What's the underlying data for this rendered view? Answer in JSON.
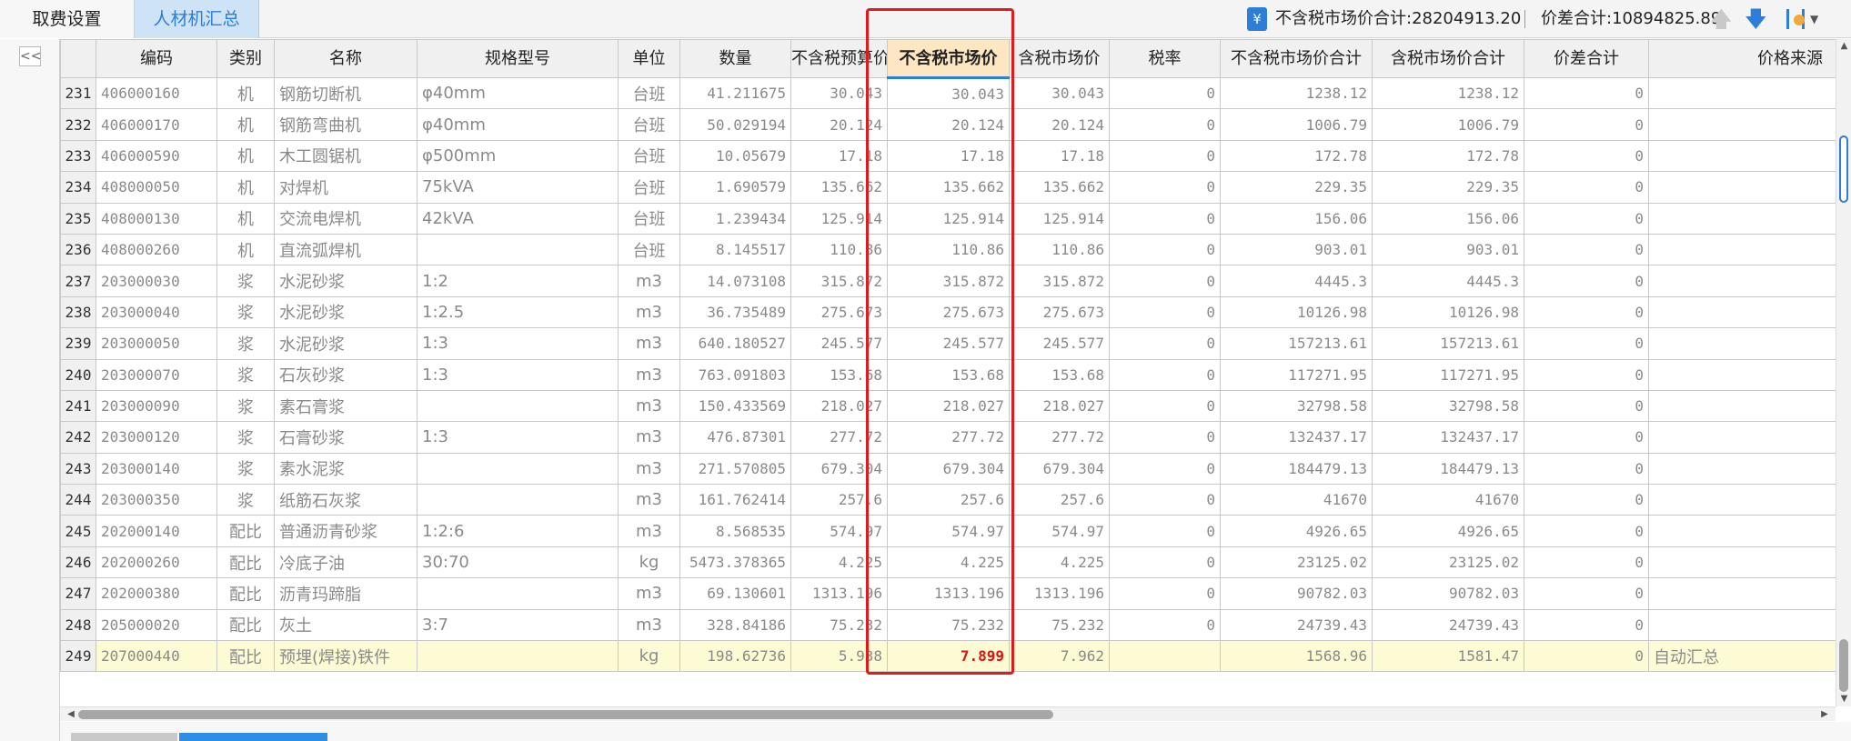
{
  "tabs": [
    "取费设置",
    "人材机汇总"
  ],
  "summary": {
    "icon": "¥",
    "market_total": "不含税市场价合计:28204913.20",
    "diff_total": "价差合计:10894825.89"
  },
  "colors": {
    "accent": "#2d7ed6",
    "highlight": "#e01b1b",
    "selected_header": "#fde7c3",
    "last_row": "#fdfbd4"
  },
  "left": {
    "collapse_glyph": "<<"
  },
  "columns": [
    "",
    "编码",
    "类别",
    "名称",
    "规格型号",
    "单位",
    "数量",
    "不含税预算价",
    "不含税市场价",
    "含税市场价",
    "税率",
    "不含税市场价合计",
    "含税市场价合计",
    "价差合计",
    "价格来源"
  ],
  "rows": [
    [
      "231",
      "406000160",
      "机",
      "钢筋切断机",
      "φ40mm",
      "台班",
      "41.211675",
      "30.043",
      "30.043",
      "30.043",
      "0",
      "1238.12",
      "1238.12",
      "0",
      ""
    ],
    [
      "232",
      "406000170",
      "机",
      "钢筋弯曲机",
      "φ40mm",
      "台班",
      "50.029194",
      "20.124",
      "20.124",
      "20.124",
      "0",
      "1006.79",
      "1006.79",
      "0",
      ""
    ],
    [
      "233",
      "406000590",
      "机",
      "木工圆锯机",
      "φ500mm",
      "台班",
      "10.05679",
      "17.18",
      "17.18",
      "17.18",
      "0",
      "172.78",
      "172.78",
      "0",
      ""
    ],
    [
      "234",
      "408000050",
      "机",
      "对焊机",
      "75kVA",
      "台班",
      "1.690579",
      "135.662",
      "135.662",
      "135.662",
      "0",
      "229.35",
      "229.35",
      "0",
      ""
    ],
    [
      "235",
      "408000130",
      "机",
      "交流电焊机",
      "42kVA",
      "台班",
      "1.239434",
      "125.914",
      "125.914",
      "125.914",
      "0",
      "156.06",
      "156.06",
      "0",
      ""
    ],
    [
      "236",
      "408000260",
      "机",
      "直流弧焊机",
      "",
      "台班",
      "8.145517",
      "110.86",
      "110.86",
      "110.86",
      "0",
      "903.01",
      "903.01",
      "0",
      ""
    ],
    [
      "237",
      "203000030",
      "浆",
      "水泥砂浆",
      "1:2",
      "m3",
      "14.073108",
      "315.872",
      "315.872",
      "315.872",
      "0",
      "4445.3",
      "4445.3",
      "0",
      ""
    ],
    [
      "238",
      "203000040",
      "浆",
      "水泥砂浆",
      "1:2.5",
      "m3",
      "36.735489",
      "275.673",
      "275.673",
      "275.673",
      "0",
      "10126.98",
      "10126.98",
      "0",
      ""
    ],
    [
      "239",
      "203000050",
      "浆",
      "水泥砂浆",
      "1:3",
      "m3",
      "640.180527",
      "245.577",
      "245.577",
      "245.577",
      "0",
      "157213.61",
      "157213.61",
      "0",
      ""
    ],
    [
      "240",
      "203000070",
      "浆",
      "石灰砂浆",
      "1:3",
      "m3",
      "763.091803",
      "153.68",
      "153.68",
      "153.68",
      "0",
      "117271.95",
      "117271.95",
      "0",
      ""
    ],
    [
      "241",
      "203000090",
      "浆",
      "素石膏浆",
      "",
      "m3",
      "150.433569",
      "218.027",
      "218.027",
      "218.027",
      "0",
      "32798.58",
      "32798.58",
      "0",
      ""
    ],
    [
      "242",
      "203000120",
      "浆",
      "石膏砂浆",
      "1:3",
      "m3",
      "476.87301",
      "277.72",
      "277.72",
      "277.72",
      "0",
      "132437.17",
      "132437.17",
      "0",
      ""
    ],
    [
      "243",
      "203000140",
      "浆",
      "素水泥浆",
      "",
      "m3",
      "271.570805",
      "679.304",
      "679.304",
      "679.304",
      "0",
      "184479.13",
      "184479.13",
      "0",
      ""
    ],
    [
      "244",
      "203000350",
      "浆",
      "纸筋石灰浆",
      "",
      "m3",
      "161.762414",
      "257.6",
      "257.6",
      "257.6",
      "0",
      "41670",
      "41670",
      "0",
      ""
    ],
    [
      "245",
      "202000140",
      "配比",
      "普通沥青砂浆",
      "1:2:6",
      "m3",
      "8.568535",
      "574.97",
      "574.97",
      "574.97",
      "0",
      "4926.65",
      "4926.65",
      "0",
      ""
    ],
    [
      "246",
      "202000260",
      "配比",
      "冷底子油",
      "30:70",
      "kg",
      "5473.378365",
      "4.225",
      "4.225",
      "4.225",
      "0",
      "23125.02",
      "23125.02",
      "0",
      ""
    ],
    [
      "247",
      "202000380",
      "配比",
      "沥青玛蹄脂",
      "",
      "m3",
      "69.130601",
      "1313.196",
      "1313.196",
      "1313.196",
      "0",
      "90782.03",
      "90782.03",
      "0",
      ""
    ],
    [
      "248",
      "205000020",
      "配比",
      "灰土",
      "3:7",
      "m3",
      "328.84186",
      "75.232",
      "75.232",
      "75.232",
      "0",
      "24739.43",
      "24739.43",
      "0",
      ""
    ],
    [
      "249",
      "207000440",
      "配比",
      "预埋(焊接)铁件",
      "",
      "kg",
      "198.62736",
      "5.938",
      "7.899",
      "7.962",
      "",
      "1568.96",
      "1581.47",
      "0",
      "自动汇总"
    ]
  ]
}
